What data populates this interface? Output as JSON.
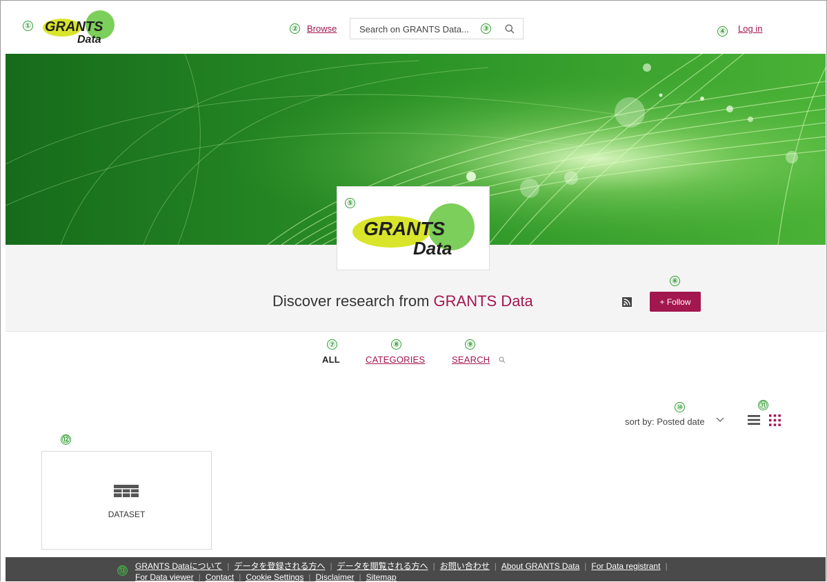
{
  "header": {
    "logo_text_1": "GRANTS",
    "logo_text_2": "Data",
    "browse_label": "Browse",
    "search_placeholder": "Search on GRANTS Data...",
    "login_label": "Log in"
  },
  "hero": {
    "logo_text_1": "GRANTS",
    "logo_text_2": "Data",
    "headline_prefix": "Discover research from ",
    "headline_brand": "GRANTS Data",
    "follow_label": "+ Follow"
  },
  "tabs": {
    "all": "ALL",
    "categories": "CATEGORIES",
    "search": "SEARCH"
  },
  "sort": {
    "label": "sort by: Posted date"
  },
  "items": [
    {
      "type_label": "DATASET"
    }
  ],
  "footer": {
    "row1": [
      "GRANTS Dataについて",
      "データを登録される方へ",
      "データを閲覧される方へ",
      "お問い合わせ",
      "About GRANTS Data",
      "For Data registrant"
    ],
    "row2": [
      "For Data viewer",
      "Contact",
      "Cookie Settings",
      "Disclaimer",
      "Sitemap"
    ]
  },
  "annotations": [
    "①",
    "②",
    "③",
    "④",
    "⑤",
    "⑥",
    "⑦",
    "⑧",
    "⑨",
    "⑩",
    "⑪",
    "⑫",
    "⑬"
  ],
  "colors": {
    "accent": "#a3174f",
    "annotation_green": "#2e9a2e",
    "banner_green": "#2f9a2a",
    "footer_bg": "#4a4a4a"
  },
  "icons": {
    "search": "magnifier-icon",
    "rss": "rss-icon",
    "chevron": "chevron-down-icon",
    "list_view": "list-view-icon",
    "grid_view": "grid-view-icon",
    "dataset": "table-icon"
  }
}
